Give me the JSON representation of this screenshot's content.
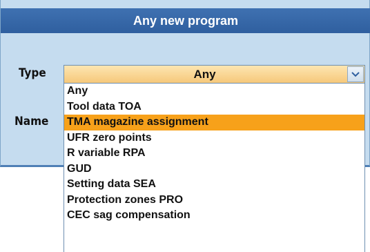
{
  "dialog": {
    "title": "Any new program",
    "type_label": "Type",
    "name_label": "Name",
    "type_value": "Any",
    "dropdown_open": true,
    "highlight_color": "#f7a11a",
    "title_bar_color": "#3a6cac",
    "options": [
      "Any",
      "Tool data TOA",
      "TMA magazine assignment",
      "UFR zero points",
      "R variable RPA",
      "GUD",
      "Setting data SEA",
      "Protection zones PRO",
      "CEC sag compensation"
    ],
    "highlighted_option": "TMA magazine assignment",
    "dropdown_icon": "chevron-down-icon"
  }
}
